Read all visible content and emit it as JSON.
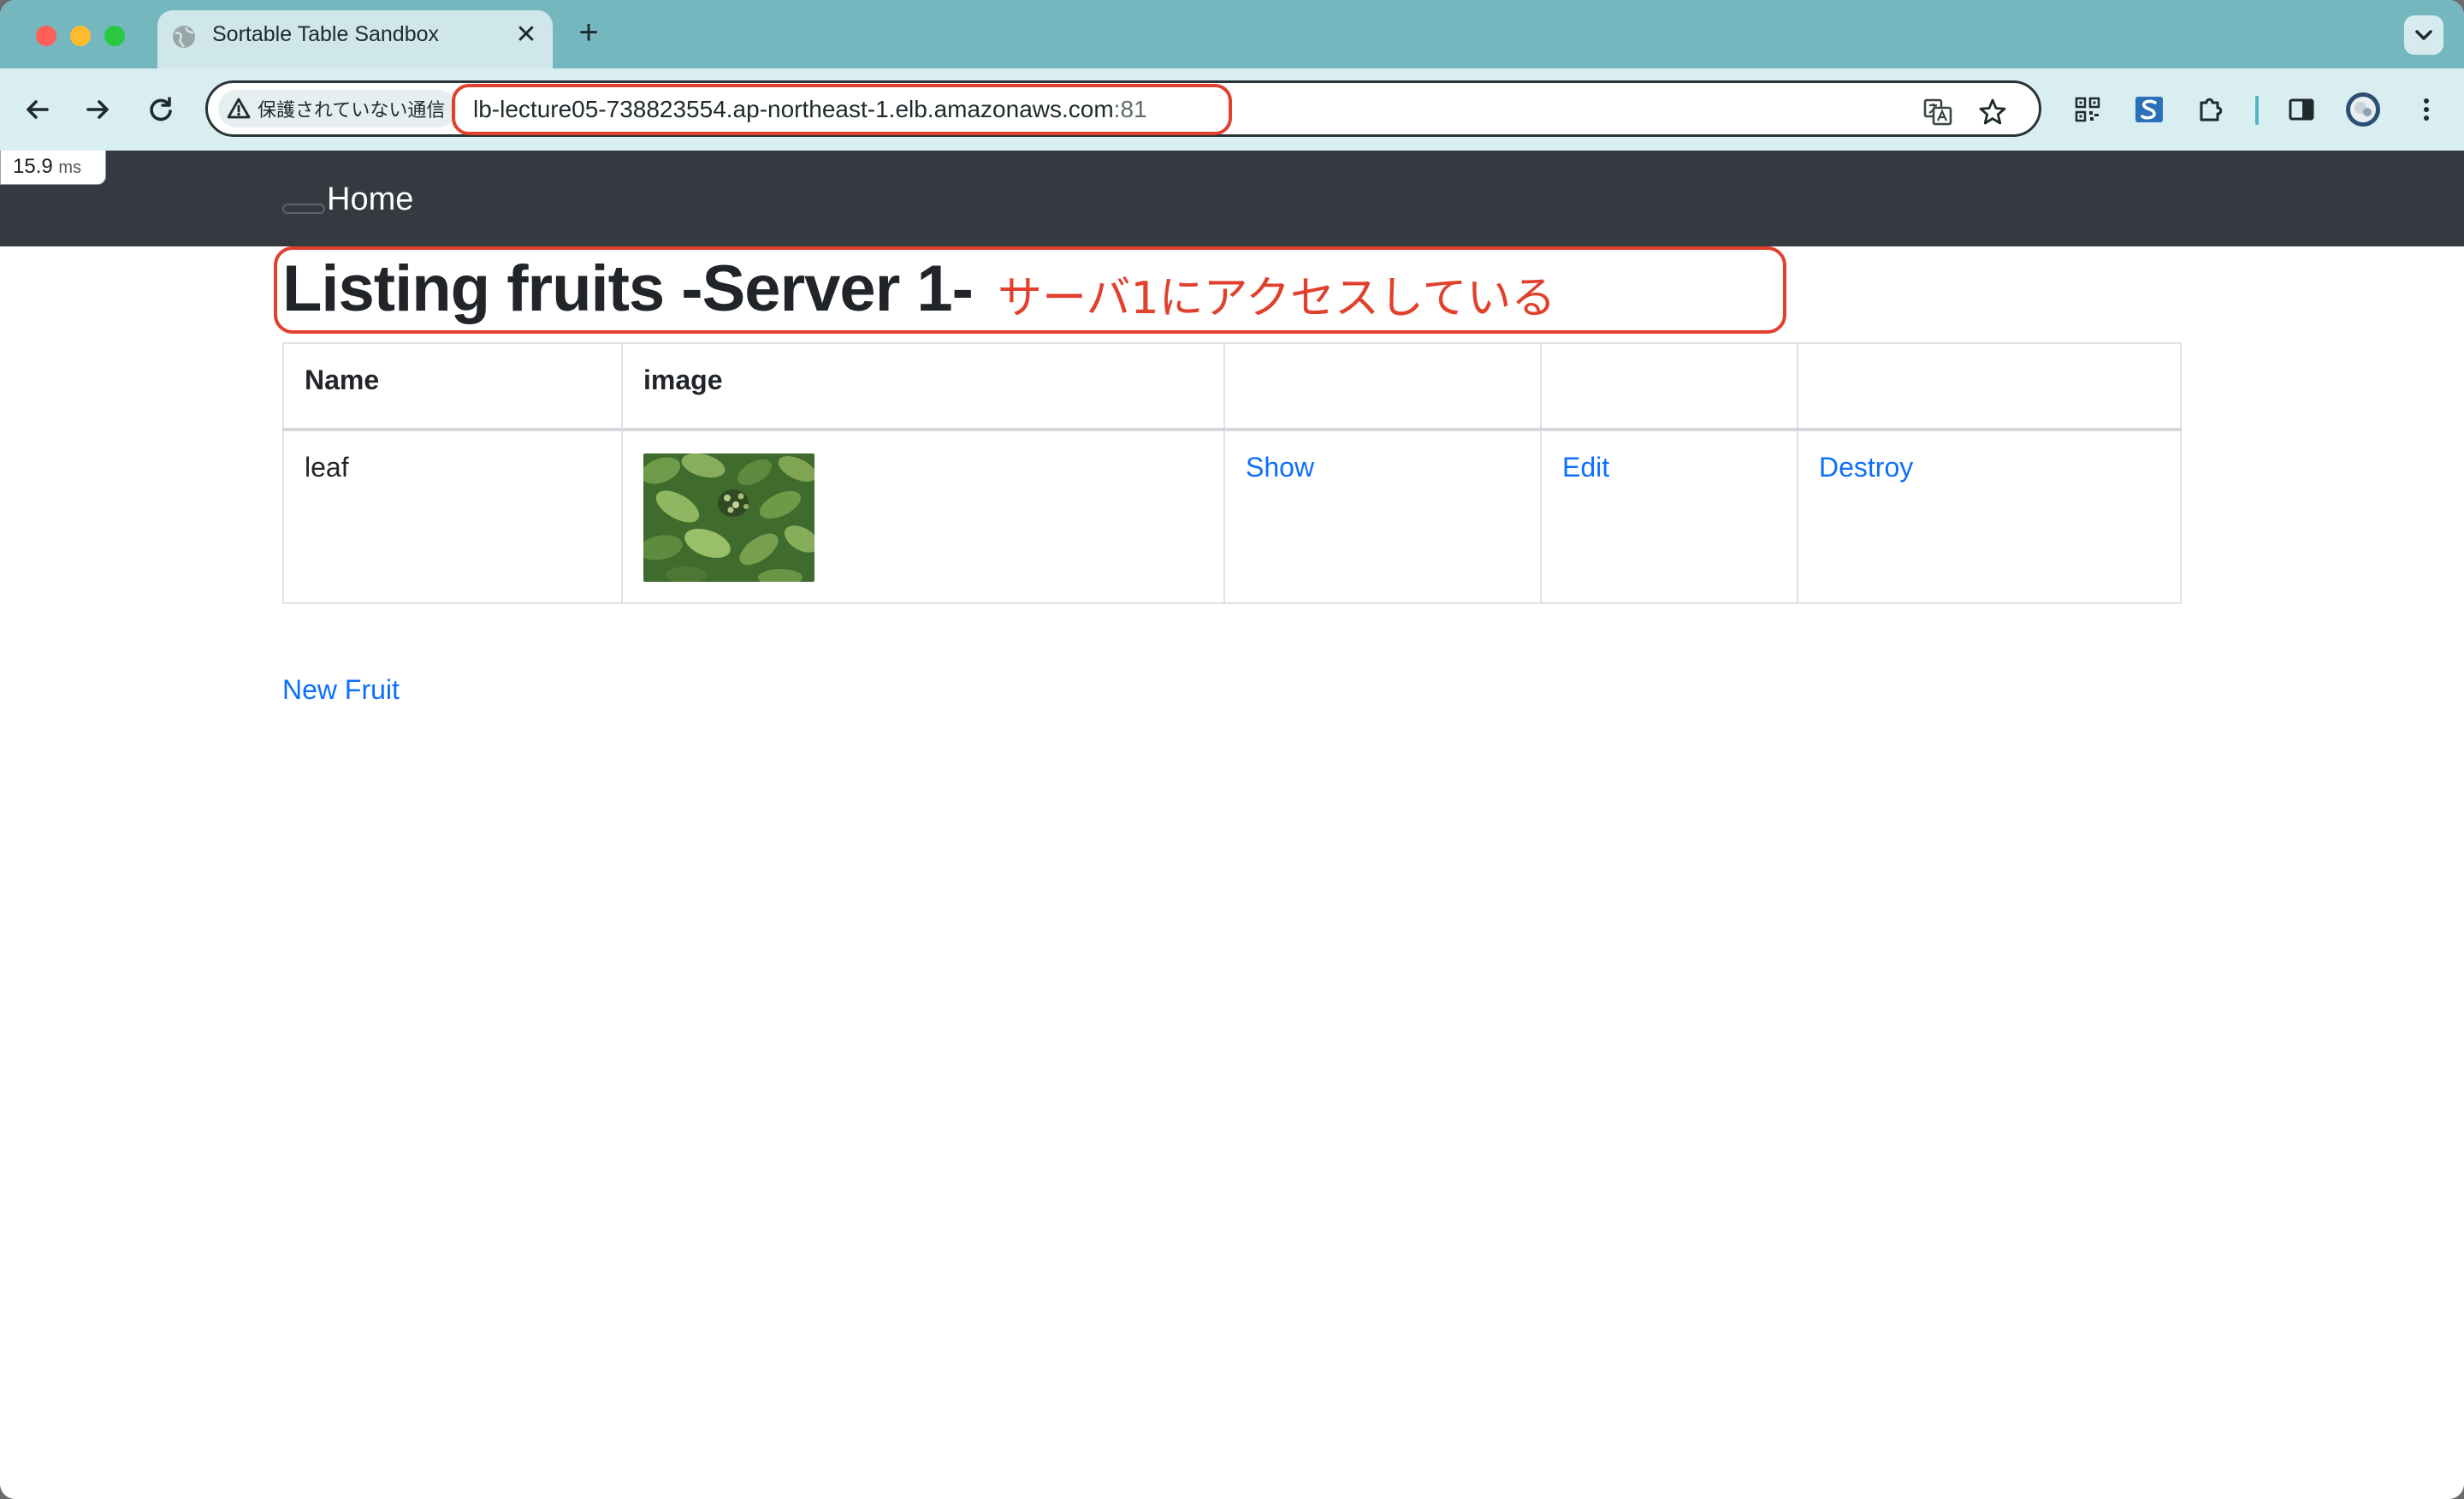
{
  "browser": {
    "tab": {
      "title": "Sortable Table Sandbox",
      "close_glyph": "✕"
    },
    "new_tab_glyph": "+",
    "security_chip": "保護されていない通信",
    "url": {
      "host": "lb-lecture05-738823554.ap-northeast-1.elb.amazonaws.com",
      "port": ":81"
    },
    "icons": [
      "back-icon",
      "forward-icon",
      "reload-icon",
      "translate-icon",
      "bookmark-star-icon",
      "qr-code-icon",
      "extension-s-icon",
      "puzzle-extensions-icon",
      "side-panel-icon",
      "profile-avatar-icon",
      "more-menu-icon"
    ],
    "annotation_color": "#e0402c"
  },
  "perf_badge": {
    "value": "15.9",
    "unit": "ms"
  },
  "navbar": {
    "home_label": "Home"
  },
  "page": {
    "heading": "Listing fruits -Server 1-",
    "annotation_note": "サーバ1にアクセスしている",
    "table": {
      "headers": [
        "Name",
        "image",
        "",
        "",
        ""
      ],
      "rows": [
        {
          "name": "leaf",
          "image_alt": "leaf",
          "show_label": "Show",
          "edit_label": "Edit",
          "destroy_label": "Destroy"
        }
      ]
    },
    "new_fruit_label": "New Fruit"
  },
  "colors": {
    "navbar_bg": "#343a40",
    "link": "#0d6efd",
    "tabstrip_bg": "#75b7bf",
    "toolbar_bg": "#d9eef1"
  }
}
